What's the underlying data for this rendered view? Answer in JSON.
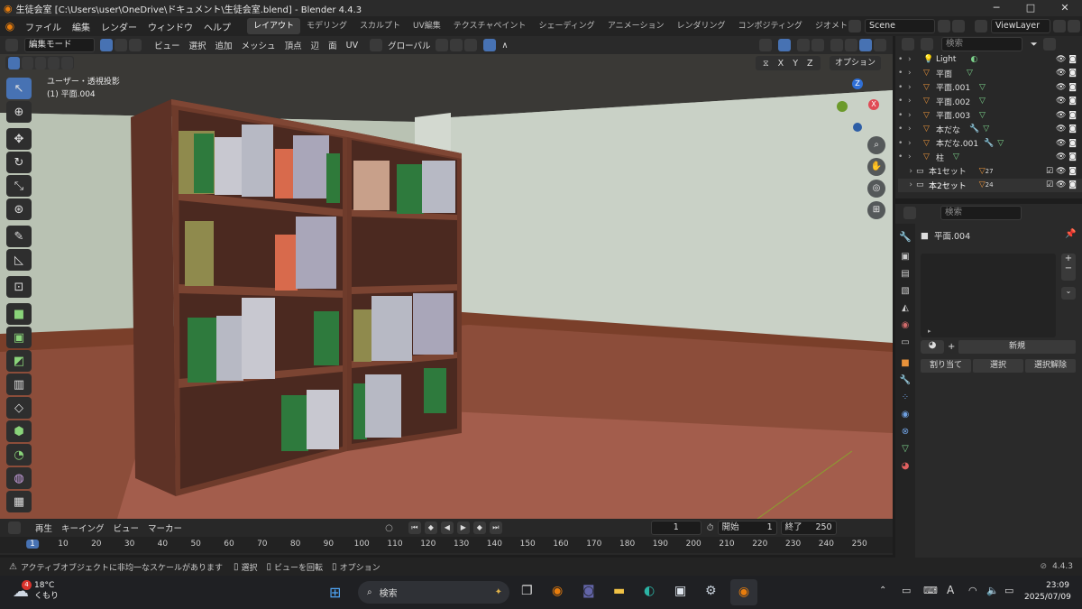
{
  "window": {
    "title": "生徒会室 [C:\\Users\\user\\OneDrive\\ドキュメント\\生徒会室.blend] - Blender 4.4.3"
  },
  "menus": [
    "ファイル",
    "編集",
    "レンダー",
    "ウィンドウ",
    "ヘルプ"
  ],
  "workspaces": [
    "レイアウト",
    "モデリング",
    "スカルプト",
    "UV編集",
    "テクスチャペイント",
    "シェーディング",
    "アニメーション",
    "レンダリング",
    "コンポジティング",
    "ジオメトリ"
  ],
  "scene": "Scene",
  "view_layer": "ViewLayer",
  "viewport_header": {
    "mode": "編集モード",
    "items": [
      "ビュー",
      "選択",
      "追加",
      "メッシュ",
      "頂点",
      "辺",
      "面",
      "UV"
    ],
    "orientation": "グローバル",
    "options": "オプション",
    "axes": [
      "X",
      "Y",
      "Z"
    ]
  },
  "viewport": {
    "view_name": "ユーザー・透視投影",
    "object": "(1) 平面.004"
  },
  "outliner": {
    "search_placeholder": "検索",
    "rows": [
      "Light",
      "平面",
      "平面.001",
      "平面.002",
      "平面.003",
      "本だな",
      "本だな.001",
      "柱"
    ],
    "collections": [
      {
        "name": "本1セット",
        "count": "27"
      },
      {
        "name": "本2セット",
        "count": "24"
      }
    ]
  },
  "properties": {
    "search_placeholder": "検索",
    "object": "平面.004",
    "new_label": "新規",
    "assign": "割り当て",
    "select": "選択",
    "deselect": "選択解除"
  },
  "timeline": {
    "menus": [
      "再生",
      "キーイング",
      "ビュー",
      "マーカー"
    ],
    "current": "1",
    "start_label": "開始",
    "start": "1",
    "end_label": "終了",
    "end": "250",
    "ticks": [
      "1",
      "10",
      "20",
      "30",
      "40",
      "50",
      "60",
      "70",
      "80",
      "90",
      "100",
      "110",
      "120",
      "130",
      "140",
      "150",
      "160",
      "170",
      "180",
      "190",
      "200",
      "210",
      "220",
      "230",
      "240",
      "250"
    ]
  },
  "status": {
    "warning": "アクティブオブジェクトに非均一なスケールがあります",
    "select": "選択",
    "rotate": "ビューを回転",
    "option": "オプション",
    "version": "4.4.3"
  },
  "taskbar": {
    "temp": "18°C",
    "weather": "くもり",
    "badge": "4",
    "search": "検索",
    "ime": "A",
    "time": "23:09",
    "date": "2025/07/09"
  }
}
